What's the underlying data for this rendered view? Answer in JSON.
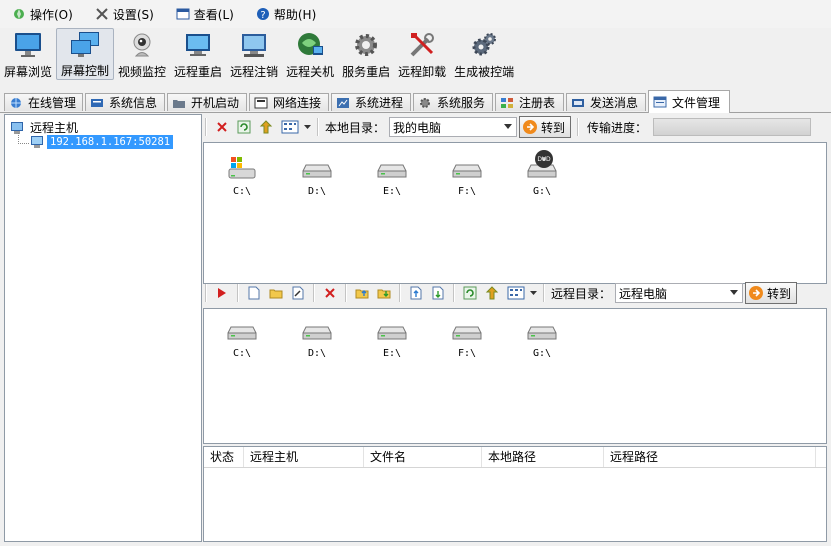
{
  "menu": [
    {
      "label": "操作(O)",
      "icon": "operate-icon"
    },
    {
      "label": "设置(S)",
      "icon": "tools-icon"
    },
    {
      "label": "查看(L)",
      "icon": "view-icon"
    },
    {
      "label": "帮助(H)",
      "icon": "help-icon"
    }
  ],
  "toolbar": [
    {
      "label": "屏幕浏览",
      "icon": "monitor-icon"
    },
    {
      "label": "屏幕控制",
      "icon": "multi-monitor-icon",
      "active": true
    },
    {
      "label": "视频监控",
      "icon": "webcam-icon"
    },
    {
      "label": "远程重启",
      "icon": "restart-icon"
    },
    {
      "label": "远程注销",
      "icon": "logoff-icon"
    },
    {
      "label": "远程关机",
      "icon": "shutdown-icon"
    },
    {
      "label": "服务重启",
      "icon": "service-gear-icon"
    },
    {
      "label": "远程卸载",
      "icon": "uninstall-tools-icon"
    },
    {
      "label": "生成被控端",
      "icon": "build-gears-icon"
    }
  ],
  "tabs": [
    {
      "label": "在线管理",
      "icon": "globe-icon"
    },
    {
      "label": "系统信息",
      "icon": "info-card-icon"
    },
    {
      "label": "开机启动",
      "icon": "folder-icon"
    },
    {
      "label": "网络连接",
      "icon": "network-icon"
    },
    {
      "label": "系统进程",
      "icon": "process-icon"
    },
    {
      "label": "系统服务",
      "icon": "service-icon"
    },
    {
      "label": "注册表",
      "icon": "registry-icon"
    },
    {
      "label": "发送消息",
      "icon": "message-icon"
    },
    {
      "label": "文件管理",
      "icon": "file-manager-icon",
      "active": true
    }
  ],
  "tree": {
    "root": "远程主机",
    "host": "192.168.1.167:50281"
  },
  "local": {
    "dir_label": "本地目录：",
    "dir_value": "我的电脑",
    "go_label": "转到",
    "progress_label": "传输进度：",
    "progress": 0,
    "drives": [
      "C:\\",
      "D:\\",
      "E:\\",
      "F:\\",
      "G:\\"
    ]
  },
  "remote": {
    "dir_label": "远程目录：",
    "dir_value": "远程电脑",
    "go_label": "转到",
    "drives": [
      "C:\\",
      "D:\\",
      "E:\\",
      "F:\\",
      "G:\\"
    ]
  },
  "transfer_columns": [
    "状态",
    "远程主机",
    "文件名",
    "本地路径",
    "远程路径"
  ]
}
